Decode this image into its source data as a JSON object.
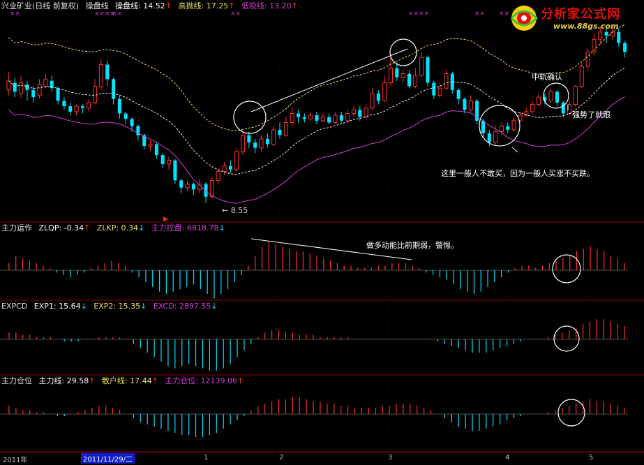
{
  "colors": {
    "up": "#ff3030",
    "down": "#00e5ff",
    "mid": "#ffffff",
    "ma_white": "#e8e8e8",
    "ma_yellow": "#e8e060",
    "ma_magenta": "#d040d0",
    "grid": "#8b0000"
  },
  "main": {
    "title": "兴业矿业(日线 前复权)",
    "ind_name": "操盘线",
    "line1": "操盘线: 14.52",
    "line1_arrow": "↑",
    "line2": "高抛线: 17.25",
    "line2_arrow": "↑",
    "line3": "低吸线: 13.20",
    "line3_arrow": "↑",
    "low_label": "8.55",
    "ann_zg": "中轨确认",
    "ann_qs": "强势了就跟",
    "ann_main": "这里一般人不敢买，因为一般人买涨不买跌。"
  },
  "sub1": {
    "name": "主力运作",
    "v1": "ZLQP: -0.34",
    "a1": "↑",
    "v2": "ZLKP: 0.34",
    "a2": "↓",
    "v3": "主力控盘: 6818.78",
    "a3": "↓",
    "ann": "做多动能比前期弱，警惕。"
  },
  "sub2": {
    "name": "EXPCD",
    "v1": "EXP1: 15.64",
    "a1": "↓",
    "v2": "EXP2: 15.35",
    "a2": "↓",
    "v3": "EXCD: 2897.55",
    "a3": "↓"
  },
  "sub3": {
    "name": "主力仓位",
    "v1": "主力线: 29.58",
    "a1": "↑",
    "v2": "散户线: 17.44",
    "a2": "↑",
    "v3": "主力仓位: 12139.06",
    "a3": "↑"
  },
  "logo": {
    "name": "分析家公式网",
    "url": "www.88gs.com"
  },
  "axis": {
    "year": "2011年",
    "date": "2011/11/29/二",
    "m1": "1",
    "m2": "2",
    "m3": "3",
    "m4": "4",
    "m5": "5"
  },
  "marks": {
    "x": "×"
  },
  "candles": [
    {
      "o": 14.8,
      "c": 15.3,
      "h": 15.8,
      "l": 14.5
    },
    {
      "o": 15.2,
      "c": 14.7,
      "h": 15.5,
      "l": 14.4
    },
    {
      "o": 14.6,
      "c": 15.2,
      "h": 15.6,
      "l": 14.4
    },
    {
      "o": 15.1,
      "c": 14.8,
      "h": 15.3,
      "l": 14.2
    },
    {
      "o": 14.8,
      "c": 14.4,
      "h": 15.0,
      "l": 14.1
    },
    {
      "o": 14.5,
      "c": 15.1,
      "h": 15.4,
      "l": 14.3
    },
    {
      "o": 15.0,
      "c": 15.4,
      "h": 15.7,
      "l": 14.9
    },
    {
      "o": 15.3,
      "c": 14.9,
      "h": 15.6,
      "l": 14.7
    },
    {
      "o": 14.9,
      "c": 14.2,
      "h": 15.0,
      "l": 14.0
    },
    {
      "o": 14.2,
      "c": 13.9,
      "h": 14.4,
      "l": 13.7
    },
    {
      "o": 13.9,
      "c": 13.6,
      "h": 14.1,
      "l": 13.4
    },
    {
      "o": 13.6,
      "c": 13.9,
      "h": 14.0,
      "l": 13.4
    },
    {
      "o": 13.9,
      "c": 13.8,
      "h": 14.0,
      "l": 13.5
    },
    {
      "o": 13.8,
      "c": 14.1,
      "h": 14.3,
      "l": 13.6
    },
    {
      "o": 14.1,
      "c": 15.0,
      "h": 15.4,
      "l": 14.0
    },
    {
      "o": 15.0,
      "c": 16.2,
      "h": 16.5,
      "l": 14.8
    },
    {
      "o": 16.2,
      "c": 15.4,
      "h": 16.4,
      "l": 15.0
    },
    {
      "o": 15.4,
      "c": 14.3,
      "h": 15.5,
      "l": 14.0
    },
    {
      "o": 14.3,
      "c": 13.5,
      "h": 14.5,
      "l": 13.2
    },
    {
      "o": 13.5,
      "c": 13.2,
      "h": 13.6,
      "l": 12.9
    },
    {
      "o": 13.2,
      "c": 12.8,
      "h": 13.3,
      "l": 12.5
    },
    {
      "o": 12.8,
      "c": 12.3,
      "h": 12.9,
      "l": 12.0
    },
    {
      "o": 12.3,
      "c": 11.7,
      "h": 12.4,
      "l": 11.5
    },
    {
      "o": 11.7,
      "c": 11.8,
      "h": 12.0,
      "l": 11.4
    },
    {
      "o": 11.8,
      "c": 11.2,
      "h": 11.9,
      "l": 11.0
    },
    {
      "o": 11.2,
      "c": 10.7,
      "h": 11.3,
      "l": 10.5
    },
    {
      "o": 10.7,
      "c": 10.9,
      "h": 11.1,
      "l": 10.4
    },
    {
      "o": 10.9,
      "c": 9.8,
      "h": 11.0,
      "l": 9.6
    },
    {
      "o": 9.8,
      "c": 9.4,
      "h": 9.9,
      "l": 9.1
    },
    {
      "o": 9.4,
      "c": 9.6,
      "h": 9.8,
      "l": 9.2
    },
    {
      "o": 9.6,
      "c": 9.3,
      "h": 9.7,
      "l": 9.0
    },
    {
      "o": 9.3,
      "c": 9.6,
      "h": 9.9,
      "l": 9.1
    },
    {
      "o": 9.6,
      "c": 8.9,
      "h": 9.7,
      "l": 8.55
    },
    {
      "o": 8.9,
      "c": 9.8,
      "h": 10.0,
      "l": 8.8
    },
    {
      "o": 9.8,
      "c": 10.3,
      "h": 10.5,
      "l": 9.6
    },
    {
      "o": 10.3,
      "c": 10.6,
      "h": 10.8,
      "l": 10.1
    },
    {
      "o": 10.6,
      "c": 10.4,
      "h": 10.9,
      "l": 10.2
    },
    {
      "o": 10.4,
      "c": 11.4,
      "h": 11.6,
      "l": 10.3
    },
    {
      "o": 11.4,
      "c": 12.3,
      "h": 12.5,
      "l": 11.2
    },
    {
      "o": 12.3,
      "c": 11.9,
      "h": 12.5,
      "l": 11.6
    },
    {
      "o": 11.9,
      "c": 11.6,
      "h": 12.1,
      "l": 11.3
    },
    {
      "o": 11.6,
      "c": 12.1,
      "h": 12.3,
      "l": 11.4
    },
    {
      "o": 12.1,
      "c": 11.8,
      "h": 12.4,
      "l": 11.6
    },
    {
      "o": 11.8,
      "c": 12.6,
      "h": 12.8,
      "l": 11.7
    },
    {
      "o": 12.6,
      "c": 12.3,
      "h": 13.0,
      "l": 12.1
    },
    {
      "o": 12.3,
      "c": 13.0,
      "h": 13.3,
      "l": 12.2
    },
    {
      "o": 13.0,
      "c": 13.5,
      "h": 13.8,
      "l": 12.8
    },
    {
      "o": 13.5,
      "c": 13.3,
      "h": 13.7,
      "l": 13.0
    },
    {
      "o": 13.3,
      "c": 13.2,
      "h": 13.5,
      "l": 13.0
    },
    {
      "o": 13.2,
      "c": 13.4,
      "h": 13.6,
      "l": 13.1
    },
    {
      "o": 13.4,
      "c": 13.1,
      "h": 13.6,
      "l": 12.9
    },
    {
      "o": 13.1,
      "c": 13.3,
      "h": 13.5,
      "l": 13.0
    },
    {
      "o": 13.3,
      "c": 13.0,
      "h": 13.5,
      "l": 12.9
    },
    {
      "o": 13.0,
      "c": 13.4,
      "h": 13.6,
      "l": 12.9
    },
    {
      "o": 13.4,
      "c": 13.1,
      "h": 13.6,
      "l": 13.0
    },
    {
      "o": 13.1,
      "c": 13.5,
      "h": 13.7,
      "l": 13.0
    },
    {
      "o": 13.5,
      "c": 13.7,
      "h": 13.9,
      "l": 13.3
    },
    {
      "o": 13.7,
      "c": 13.3,
      "h": 13.9,
      "l": 13.1
    },
    {
      "o": 13.3,
      "c": 13.8,
      "h": 14.0,
      "l": 13.2
    },
    {
      "o": 13.8,
      "c": 14.6,
      "h": 14.9,
      "l": 13.7
    },
    {
      "o": 14.6,
      "c": 14.2,
      "h": 14.8,
      "l": 14.0
    },
    {
      "o": 14.2,
      "c": 15.2,
      "h": 15.6,
      "l": 14.1
    },
    {
      "o": 15.2,
      "c": 16.0,
      "h": 16.8,
      "l": 15.0
    },
    {
      "o": 16.0,
      "c": 15.5,
      "h": 16.3,
      "l": 15.3
    },
    {
      "o": 15.5,
      "c": 15.7,
      "h": 15.9,
      "l": 15.2
    },
    {
      "o": 15.7,
      "c": 15.0,
      "h": 15.9,
      "l": 14.9
    },
    {
      "o": 15.0,
      "c": 15.6,
      "h": 16.0,
      "l": 14.9
    },
    {
      "o": 15.6,
      "c": 16.6,
      "h": 16.9,
      "l": 15.5
    },
    {
      "o": 16.6,
      "c": 15.2,
      "h": 16.7,
      "l": 15.0
    },
    {
      "o": 15.2,
      "c": 14.5,
      "h": 15.3,
      "l": 14.3
    },
    {
      "o": 14.5,
      "c": 14.9,
      "h": 15.2,
      "l": 14.4
    },
    {
      "o": 14.9,
      "c": 15.7,
      "h": 15.9,
      "l": 14.8
    },
    {
      "o": 15.7,
      "c": 14.8,
      "h": 15.8,
      "l": 14.6
    },
    {
      "o": 14.8,
      "c": 14.3,
      "h": 14.9,
      "l": 14.0
    },
    {
      "o": 14.3,
      "c": 13.7,
      "h": 14.4,
      "l": 13.5
    },
    {
      "o": 13.7,
      "c": 14.2,
      "h": 14.5,
      "l": 13.6
    },
    {
      "o": 14.2,
      "c": 13.1,
      "h": 14.3,
      "l": 12.9
    },
    {
      "o": 13.1,
      "c": 12.4,
      "h": 13.2,
      "l": 12.2
    },
    {
      "o": 12.4,
      "c": 11.9,
      "h": 12.6,
      "l": 11.7
    },
    {
      "o": 11.9,
      "c": 12.5,
      "h": 12.8,
      "l": 11.8
    },
    {
      "o": 12.5,
      "c": 12.8,
      "h": 13.0,
      "l": 12.3
    },
    {
      "o": 12.8,
      "c": 12.6,
      "h": 13.0,
      "l": 12.4
    },
    {
      "o": 12.6,
      "c": 13.1,
      "h": 13.3,
      "l": 12.5
    },
    {
      "o": 13.1,
      "c": 13.4,
      "h": 13.6,
      "l": 13.0
    },
    {
      "o": 13.4,
      "c": 13.6,
      "h": 13.8,
      "l": 13.3
    },
    {
      "o": 13.6,
      "c": 14.0,
      "h": 14.2,
      "l": 13.5
    },
    {
      "o": 14.0,
      "c": 14.4,
      "h": 14.6,
      "l": 13.9
    },
    {
      "o": 14.4,
      "c": 14.2,
      "h": 14.6,
      "l": 14.0
    },
    {
      "o": 14.2,
      "c": 14.7,
      "h": 14.9,
      "l": 14.1
    },
    {
      "o": 14.7,
      "c": 14.1,
      "h": 14.8,
      "l": 13.9
    },
    {
      "o": 14.1,
      "c": 13.5,
      "h": 14.2,
      "l": 13.3
    },
    {
      "o": 13.5,
      "c": 14.0,
      "h": 14.2,
      "l": 13.4
    },
    {
      "o": 14.0,
      "c": 15.0,
      "h": 15.1,
      "l": 13.9
    },
    {
      "o": 15.0,
      "c": 16.1,
      "h": 16.3,
      "l": 14.9
    },
    {
      "o": 16.1,
      "c": 16.9,
      "h": 17.1,
      "l": 15.9
    },
    {
      "o": 16.9,
      "c": 17.6,
      "h": 17.9,
      "l": 16.7
    },
    {
      "o": 17.6,
      "c": 18.0,
      "h": 18.3,
      "l": 17.3
    },
    {
      "o": 18.0,
      "c": 17.8,
      "h": 18.2,
      "l": 17.4
    },
    {
      "o": 17.8,
      "c": 18.0,
      "h": 18.3,
      "l": 17.6
    },
    {
      "o": 18.0,
      "c": 17.4,
      "h": 18.2,
      "l": 17.2
    },
    {
      "o": 17.4,
      "c": 16.9,
      "h": 17.5,
      "l": 16.6
    }
  ],
  "osc1": [
    3,
    6,
    5,
    4,
    3,
    2,
    1,
    -1,
    -2,
    -3,
    -2,
    -1,
    1,
    2,
    3,
    4,
    3,
    2,
    -1,
    -3,
    -5,
    -7,
    -9,
    -10,
    -9,
    -8,
    -7,
    -6,
    -8,
    -10,
    -12,
    -10,
    -8,
    -5,
    -2,
    2,
    6,
    10,
    12,
    11,
    10,
    9,
    8,
    8,
    7,
    6,
    5,
    4,
    3,
    2,
    2,
    1,
    1,
    1,
    2,
    2,
    3,
    3,
    3,
    2,
    1,
    -1,
    -2,
    -3,
    -4,
    -6,
    -8,
    -9,
    -10,
    -9,
    -7,
    -5,
    -3,
    -1,
    1,
    2,
    2,
    1,
    2,
    3,
    4,
    5,
    6,
    8,
    9,
    10,
    9,
    8,
    6,
    5,
    3
  ],
  "osc2": [
    3,
    3,
    2,
    2,
    1,
    1,
    1,
    0,
    -1,
    -1,
    -1,
    0,
    0,
    1,
    1,
    1,
    1,
    0,
    -2,
    -4,
    -6,
    -8,
    -10,
    -12,
    -13,
    -12,
    -11,
    -12,
    -13,
    -14,
    -14,
    -13,
    -11,
    -8,
    -5,
    -2,
    1,
    3,
    4,
    4,
    3,
    3,
    2,
    2,
    2,
    1,
    1,
    1,
    1,
    1,
    0,
    0,
    0,
    0,
    0,
    0,
    0,
    0,
    0,
    0,
    0,
    0,
    -1,
    -2,
    -3,
    -4,
    -5,
    -6,
    -6,
    -6,
    -5,
    -4,
    -3,
    -2,
    -1,
    0,
    0,
    0,
    1,
    2,
    3,
    4,
    5,
    7,
    8,
    9,
    9,
    8,
    7,
    6
  ],
  "osc3": [
    4,
    3,
    2,
    2,
    1,
    1,
    0,
    -1,
    -1,
    0,
    1,
    2,
    3,
    4,
    4,
    3,
    2,
    0,
    -2,
    -4,
    -5,
    -6,
    -7,
    -8,
    -9,
    -10,
    -10,
    -11,
    -11,
    -10,
    -9,
    -7,
    -5,
    -3,
    -1,
    2,
    4,
    5,
    6,
    7,
    7,
    8,
    8,
    7,
    6,
    6,
    5,
    5,
    4,
    4,
    3,
    3,
    3,
    3,
    4,
    4,
    5,
    5,
    5,
    4,
    3,
    2,
    0,
    -2,
    -4,
    -6,
    -7,
    -8,
    -8,
    -7,
    -6,
    -5,
    -3,
    -2,
    -1,
    0,
    0,
    0,
    1,
    2,
    3,
    4,
    5,
    6,
    7,
    6,
    6,
    5,
    4,
    3
  ]
}
